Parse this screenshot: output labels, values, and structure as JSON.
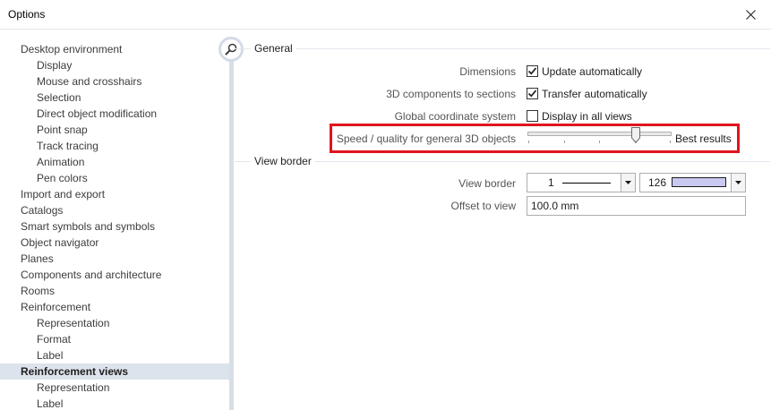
{
  "window": {
    "title": "Options"
  },
  "tree": [
    {
      "label": "Desktop environment",
      "level": 0
    },
    {
      "label": "Display",
      "level": 1
    },
    {
      "label": "Mouse and crosshairs",
      "level": 1
    },
    {
      "label": "Selection",
      "level": 1
    },
    {
      "label": "Direct object modification",
      "level": 1
    },
    {
      "label": "Point snap",
      "level": 1
    },
    {
      "label": "Track tracing",
      "level": 1
    },
    {
      "label": "Animation",
      "level": 1
    },
    {
      "label": "Pen colors",
      "level": 1
    },
    {
      "label": "Import and export",
      "level": 0
    },
    {
      "label": "Catalogs",
      "level": 0
    },
    {
      "label": "Smart symbols and symbols",
      "level": 0
    },
    {
      "label": "Object navigator",
      "level": 0
    },
    {
      "label": "Planes",
      "level": 0
    },
    {
      "label": "Components and architecture",
      "level": 0
    },
    {
      "label": "Rooms",
      "level": 0
    },
    {
      "label": "Reinforcement",
      "level": 0
    },
    {
      "label": "Representation",
      "level": 1
    },
    {
      "label": "Format",
      "level": 1
    },
    {
      "label": "Label",
      "level": 1
    },
    {
      "label": "Reinforcement views",
      "level": 0,
      "selected": true
    },
    {
      "label": "Representation",
      "level": 1
    },
    {
      "label": "Label",
      "level": 1
    }
  ],
  "general": {
    "heading": "General",
    "dimensions": {
      "label": "Dimensions",
      "checkbox_label": "Update automatically",
      "checked": true
    },
    "components_3d": {
      "label": "3D components to sections",
      "checkbox_label": "Transfer automatically",
      "checked": true
    },
    "global_coord": {
      "label": "Global coordinate system",
      "checkbox_label": "Display in all views",
      "checked": false
    },
    "speed_quality": {
      "label": "Speed / quality for general 3D objects",
      "slider_caption": "Best results",
      "value_fraction": 0.75
    }
  },
  "view_border": {
    "heading": "View border",
    "border": {
      "label": "View border",
      "line_value": "1",
      "color_value": "126",
      "color_swatch": "#c8c8f0"
    },
    "offset": {
      "label": "Offset to view",
      "value": "100.0 mm"
    }
  },
  "colors": {
    "highlight": "#e0141e",
    "selection_bg": "#dde3ec",
    "divider": "#d8dee8"
  },
  "icons": {
    "close": "close-icon",
    "search": "search-icon",
    "checkmark": "checkmark-icon",
    "dropdown": "chevron-down-icon"
  }
}
